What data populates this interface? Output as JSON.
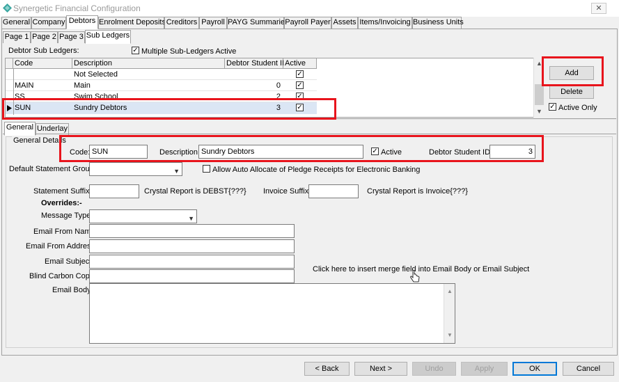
{
  "window": {
    "title": "Synergetic Financial Configuration",
    "close_label": "✕"
  },
  "main_tabs": [
    {
      "label": "General"
    },
    {
      "label": "Company"
    },
    {
      "label": "Debtors"
    },
    {
      "label": "Enrolment Deposits"
    },
    {
      "label": "Creditors"
    },
    {
      "label": "Payroll"
    },
    {
      "label": "PAYG Summaries"
    },
    {
      "label": "Payroll Payer"
    },
    {
      "label": "Assets"
    },
    {
      "label": "Items/Invoicing"
    },
    {
      "label": "Business Units"
    }
  ],
  "sub_tabs": [
    {
      "label": "Page 1"
    },
    {
      "label": "Page 2"
    },
    {
      "label": "Page 3"
    },
    {
      "label": "Sub Ledgers"
    }
  ],
  "sub_ledgers": {
    "label": "Debtor Sub Ledgers:",
    "multiple_label": "Multiple Sub-Ledgers Active",
    "multiple_checked": "✓",
    "columns": [
      "Code",
      "Description",
      "Debtor Student ID",
      "Active"
    ],
    "rows": [
      {
        "code": "",
        "description": "Not Selected",
        "student_id": "",
        "active": "✓"
      },
      {
        "code": "MAIN",
        "description": "Main",
        "student_id": "0",
        "active": "✓"
      },
      {
        "code": "SS",
        "description": "Swim School",
        "student_id": "2",
        "active": "✓"
      },
      {
        "code": "SUN",
        "description": "Sundry Debtors",
        "student_id": "3",
        "active": "✓"
      }
    ],
    "add_label": "Add",
    "delete_label": "Delete",
    "active_only_label": "Active Only",
    "active_only_checked": "✓"
  },
  "detail_tabs": [
    {
      "label": "General"
    },
    {
      "label": "Underlay"
    }
  ],
  "general_details": {
    "group_label": "General Details",
    "code_label": "Code:",
    "code_value": "SUN",
    "description_label": "Description:",
    "description_value": "Sundry Debtors",
    "active_label": "Active",
    "active_checked": "✓",
    "student_id_label": "Debtor Student ID:",
    "student_id_value": "3",
    "statement_group_label": "Default Statement Group:",
    "statement_group_value": "",
    "allow_auto_label": "Allow Auto Allocate of Pledge Receipts for Electronic Banking",
    "statement_suffix_label": "Statement Suffix:",
    "statement_suffix_value": "",
    "crystal_debst": "Crystal Report is DEBST{???}",
    "invoice_suffix_label": "Invoice Suffix:",
    "invoice_suffix_value": "",
    "crystal_invoice": "Crystal Report is Invoice{???}",
    "overrides_label": "Overrides:-",
    "message_type_label": "Message Type:",
    "message_type_value": "",
    "email_from_name_label": "Email From Name:",
    "email_from_address_label": "Email From Address:",
    "email_subject_label": "Email Subject:",
    "bcc_label": "Blind Carbon Copy:",
    "email_body_label": "Email Body:",
    "merge_link": "Click here to insert merge field into Email Body or Email Subject"
  },
  "footer": {
    "back": "< Back",
    "next": "Next >",
    "undo": "Undo",
    "apply": "Apply",
    "ok": "OK",
    "cancel": "Cancel"
  },
  "colors": {
    "highlight": "#e8141c",
    "selected_row": "#dbe6f4",
    "link": "#1a3c8f"
  }
}
